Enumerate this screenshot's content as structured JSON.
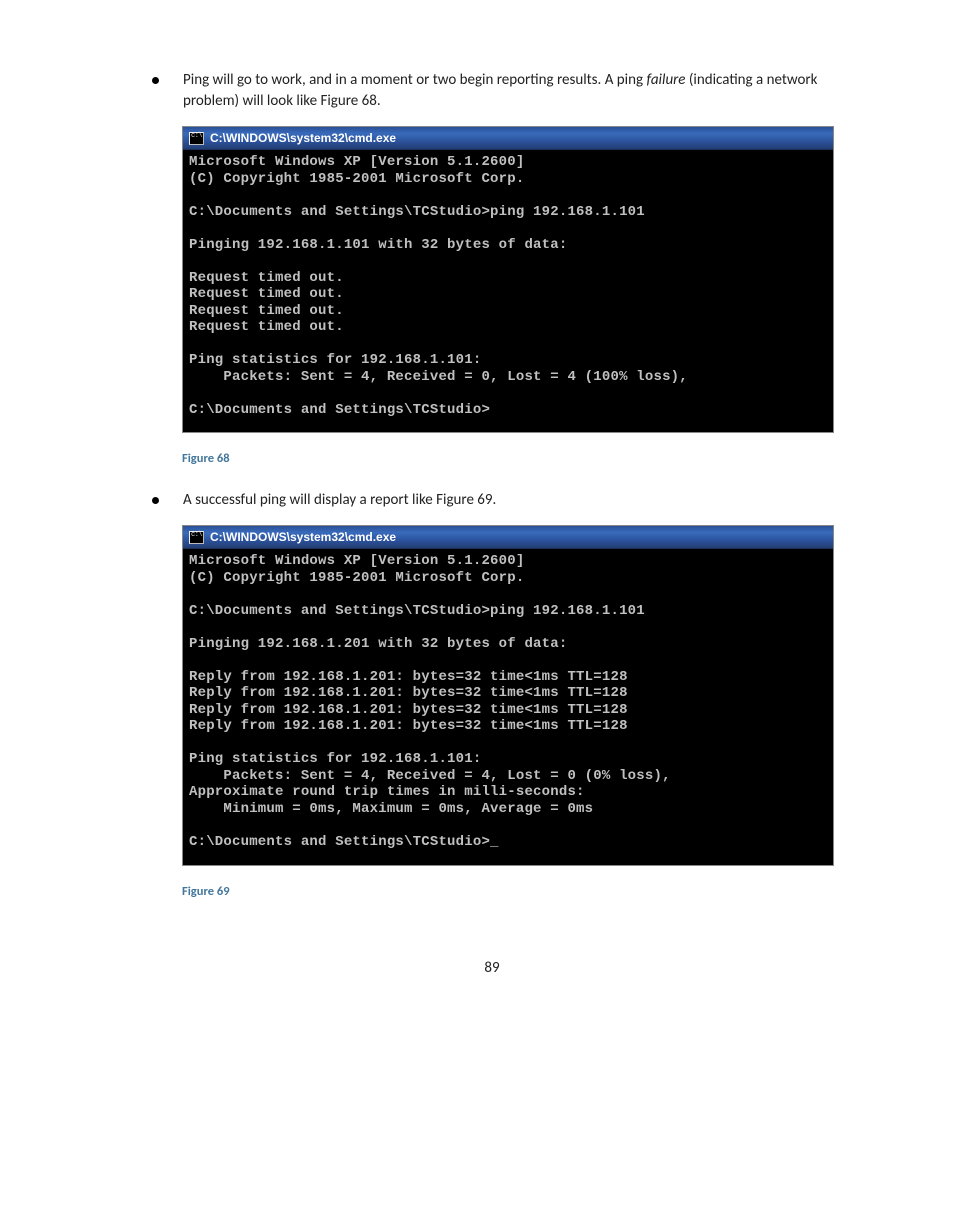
{
  "bullet1": {
    "pre": "Ping will go to work, and in a moment or two begin reporting results.  A ping ",
    "italic": "failure",
    "post": " (indicating a network problem) will look like Figure 68."
  },
  "bullet2": {
    "text": "A successful ping will display a report like Figure 69."
  },
  "cmd1": {
    "titlebar": "C:\\WINDOWS\\system32\\cmd.exe",
    "lines": [
      "Microsoft Windows XP [Version 5.1.2600]",
      "(C) Copyright 1985-2001 Microsoft Corp.",
      "",
      "C:\\Documents and Settings\\TCStudio>ping 192.168.1.101",
      "",
      "Pinging 192.168.1.101 with 32 bytes of data:",
      "",
      "Request timed out.",
      "Request timed out.",
      "Request timed out.",
      "Request timed out.",
      "",
      "Ping statistics for 192.168.1.101:",
      "    Packets: Sent = 4, Received = 0, Lost = 4 (100% loss),",
      "",
      "C:\\Documents and Settings\\TCStudio>",
      ""
    ]
  },
  "caption1": "Figure 68",
  "cmd2": {
    "titlebar": "C:\\WINDOWS\\system32\\cmd.exe",
    "lines": [
      "Microsoft Windows XP [Version 5.1.2600]",
      "(C) Copyright 1985-2001 Microsoft Corp.",
      "",
      "C:\\Documents and Settings\\TCStudio>ping 192.168.1.101",
      "",
      "Pinging 192.168.1.201 with 32 bytes of data:",
      "",
      "Reply from 192.168.1.201: bytes=32 time<1ms TTL=128",
      "Reply from 192.168.1.201: bytes=32 time<1ms TTL=128",
      "Reply from 192.168.1.201: bytes=32 time<1ms TTL=128",
      "Reply from 192.168.1.201: bytes=32 time<1ms TTL=128",
      "",
      "Ping statistics for 192.168.1.101:",
      "    Packets: Sent = 4, Received = 4, Lost = 0 (0% loss),",
      "Approximate round trip times in milli-seconds:",
      "    Minimum = 0ms, Maximum = 0ms, Average = 0ms",
      "",
      "C:\\Documents and Settings\\TCStudio>_",
      ""
    ]
  },
  "caption2": "Figure 69",
  "page_number": "89"
}
